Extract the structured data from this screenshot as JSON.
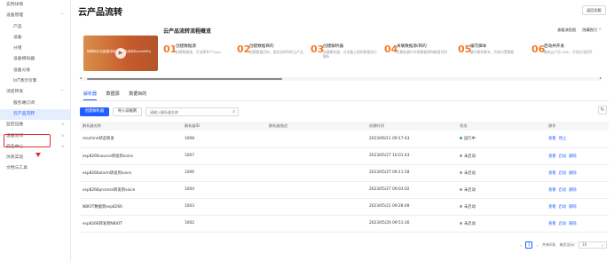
{
  "sidebar": {
    "items": [
      {
        "label": "实例详情",
        "sub": false,
        "chevron": ""
      },
      {
        "label": "设备管理",
        "sub": false,
        "chevron": "^"
      },
      {
        "label": "产品",
        "sub": true,
        "chevron": ""
      },
      {
        "label": "设备",
        "sub": true,
        "chevron": ""
      },
      {
        "label": "分组",
        "sub": true,
        "chevron": ""
      },
      {
        "label": "设备模拟器",
        "sub": true,
        "chevron": ""
      },
      {
        "label": "设备分发",
        "sub": true,
        "chevron": ""
      },
      {
        "label": "IoT演示引擎",
        "sub": true,
        "chevron": ""
      },
      {
        "label": "消息转发",
        "sub": false,
        "chevron": "^"
      },
      {
        "label": "服务端订阅",
        "sub": true,
        "chevron": ""
      },
      {
        "label": "云产品流转",
        "sub": true,
        "chevron": "",
        "active": true
      },
      {
        "label": "监控运维",
        "sub": false,
        "chevron": "v"
      },
      {
        "label": "设备划归",
        "sub": false,
        "chevron": "v"
      },
      {
        "label": "安全中心",
        "sub": false,
        "chevron": "v"
      },
      {
        "label": "仿真实验",
        "sub": false,
        "chevron": ""
      },
      {
        "label": "文档与工具",
        "sub": false,
        "chevron": ""
      }
    ]
  },
  "header": {
    "title": "云产品流转",
    "back_label": "返回旧版"
  },
  "overview": {
    "title": "云产品流转流程概览",
    "link_process": "查看流程图",
    "link_collapse": "隐藏指引 ^",
    "video_text": "物联网平台数据流转 (云产品流转RocketMQ)",
    "play_icon": "play-icon",
    "steps": [
      {
        "num": "01",
        "title": "创建数据源",
        "desc": "创建数据源，可选择多个Topic"
      },
      {
        "num": "02",
        "title": "创建数据目的",
        "desc": "创建数据目的，指定流转到的云产品"
      },
      {
        "num": "03",
        "title": "创建解析器",
        "desc": "创建解析器，对设备上报的数据进行解析"
      },
      {
        "num": "04",
        "title": "关联数据源/目的",
        "desc": "在解析器中关联数据源和数据目的"
      },
      {
        "num": "05",
        "title": "编写脚本",
        "desc": "编写解析脚本，完成内置模板"
      },
      {
        "num": "06",
        "title": "启动并开发",
        "desc": "集成云产品 SDK，开发应用程序"
      }
    ]
  },
  "tabs": [
    "解析器",
    "数据源",
    "数据目的"
  ],
  "toolbar": {
    "create_label": "创建解析器",
    "import_label": "导入旧规则",
    "search_placeholder": "请输入解析器名称"
  },
  "table": {
    "columns": [
      "解析器名称",
      "解析器ID",
      "解析器描述",
      "创建时间",
      "状态",
      "操作"
    ],
    "rows": [
      {
        "name": "machine状态转发",
        "id": "1008",
        "desc": "",
        "time": "2023/06/11 09:17:43",
        "status": "运行中",
        "status_color": "#2bb94a",
        "ops": [
          "查看",
          "停止"
        ]
      },
      {
        "name": "esp8266source转发到voice",
        "id": "1007",
        "desc": "",
        "time": "2023/05/27 10:01:43",
        "status": "未启动",
        "status_color": "#999999",
        "ops": [
          "查看",
          "启动",
          "删除"
        ]
      },
      {
        "name": "esp8266alarm转发到voice",
        "id": "1006",
        "desc": "",
        "time": "2023/05/27 09:11:18",
        "status": "未启动",
        "status_color": "#999999",
        "ops": [
          "查看",
          "启动",
          "删除"
        ]
      },
      {
        "name": "esp8266process转发到voice",
        "id": "1004",
        "desc": "",
        "time": "2023/05/27 09:03:02",
        "status": "未启动",
        "status_color": "#999999",
        "ops": [
          "查看",
          "启动",
          "删除"
        ]
      },
      {
        "name": "NBIOT数据到esp8266",
        "id": "1003",
        "desc": "",
        "time": "2023/05/21 09:28:48",
        "status": "未启动",
        "status_color": "#999999",
        "ops": [
          "查看",
          "启动",
          "删除"
        ]
      },
      {
        "name": "esp8266转发到NBIOT",
        "id": "1002",
        "desc": "",
        "time": "2023/05/20 09:51:16",
        "status": "未启动",
        "status_color": "#999999",
        "ops": [
          "查看",
          "启动",
          "删除"
        ]
      }
    ]
  },
  "pager": {
    "current": "1",
    "total_text": "共有6条",
    "size_label": "每页显示:",
    "size_value": "10"
  },
  "colors": {
    "accent": "#1f5fff",
    "step_num": "#f07a2a",
    "highlight": "#e03030"
  }
}
